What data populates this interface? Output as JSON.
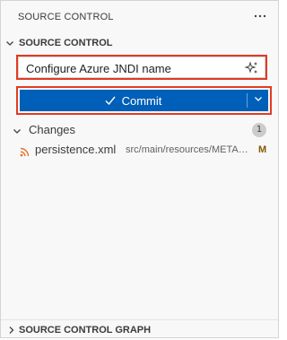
{
  "panel": {
    "header_label": "SOURCE CONTROL"
  },
  "section": {
    "title": "SOURCE CONTROL"
  },
  "commit": {
    "message_value": "Configure Azure JNDI name",
    "button_label": "Commit"
  },
  "changes": {
    "label": "Changes",
    "count": "1",
    "files": [
      {
        "name": "persistence.xml",
        "path": "src/main/resources/META-INF",
        "status": "M"
      }
    ]
  },
  "graph": {
    "title": "SOURCE CONTROL GRAPH"
  },
  "colors": {
    "accent": "#005fb8",
    "highlight_border": "#e23a22",
    "modified_status": "#895503",
    "rss_icon": "#e8742a"
  },
  "icons": {
    "more": "more-actions-icon",
    "sparkle": "sparkle-icon",
    "check": "check-icon",
    "chevron": "chevron-down-icon",
    "file": "rss-file-icon"
  }
}
